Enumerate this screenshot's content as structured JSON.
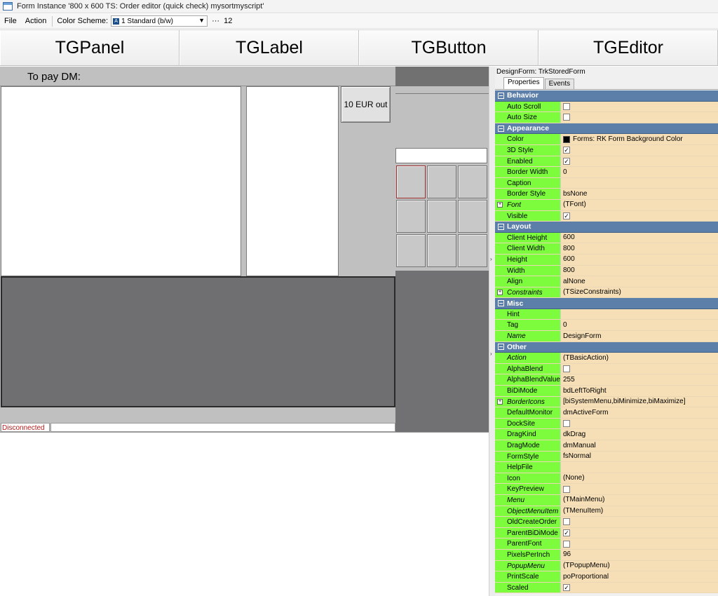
{
  "window": {
    "title": "Form Instance '800 x 600 TS: Order editor (quick check) mysortmyscript'"
  },
  "menu": {
    "file": "File",
    "action": "Action",
    "color_scheme_label": "Color Scheme:",
    "color_scheme_value": "1 Standard (b/w)",
    "more": "···",
    "count": "12"
  },
  "palette": [
    "TGPanel",
    "TGLabel",
    "TGButton",
    "TGEditor"
  ],
  "form": {
    "label": "To pay DM:",
    "eur_button": "10 EUR out",
    "status": "Disconnected"
  },
  "inspector": {
    "title": "DesignForm: TrkStoredForm",
    "tabs": [
      "Properties",
      "Events"
    ],
    "sections": [
      {
        "name": "Behavior",
        "rows": [
          {
            "name": "Auto Scroll",
            "type": "check",
            "checked": false
          },
          {
            "name": "Auto Size",
            "type": "check",
            "checked": false
          }
        ]
      },
      {
        "name": "Appearance",
        "rows": [
          {
            "name": "Color",
            "type": "color",
            "value": "Forms: RK Form Background Color",
            "color": "#000000"
          },
          {
            "name": "3D Style",
            "type": "check",
            "checked": true
          },
          {
            "name": "Enabled",
            "type": "check",
            "checked": true
          },
          {
            "name": "Border Width",
            "type": "text",
            "value": "0"
          },
          {
            "name": "Caption",
            "type": "text",
            "value": ""
          },
          {
            "name": "Border Style",
            "type": "text",
            "value": "bsNone"
          },
          {
            "name": "Font",
            "type": "text",
            "value": "(TFont)",
            "italic": true,
            "expand": true
          },
          {
            "name": "Visible",
            "type": "check",
            "checked": true
          }
        ]
      },
      {
        "name": "Layout",
        "rows": [
          {
            "name": "Client Height",
            "type": "text",
            "value": "600"
          },
          {
            "name": "Client Width",
            "type": "text",
            "value": "800"
          },
          {
            "name": "Height",
            "type": "text",
            "value": "600"
          },
          {
            "name": "Width",
            "type": "text",
            "value": "800"
          },
          {
            "name": "Align",
            "type": "text",
            "value": "alNone"
          },
          {
            "name": "Constraints",
            "type": "text",
            "value": "(TSizeConstraints)",
            "italic": true,
            "expand": true
          }
        ]
      },
      {
        "name": "Misc",
        "rows": [
          {
            "name": "Hint",
            "type": "text",
            "value": ""
          },
          {
            "name": "Tag",
            "type": "text",
            "value": "0"
          },
          {
            "name": "Name",
            "type": "text",
            "value": "DesignForm",
            "italic": true
          }
        ]
      },
      {
        "name": "Other",
        "rows": [
          {
            "name": "Action",
            "type": "text",
            "value": "(TBasicAction)",
            "italic": true
          },
          {
            "name": "AlphaBlend",
            "type": "check",
            "checked": false
          },
          {
            "name": "AlphaBlendValue",
            "type": "text",
            "value": "255"
          },
          {
            "name": "BiDiMode",
            "type": "text",
            "value": "bdLeftToRight"
          },
          {
            "name": "BorderIcons",
            "type": "text",
            "value": "[biSystemMenu,biMinimize,biMaximize]",
            "italic": true,
            "expand": true
          },
          {
            "name": "DefaultMonitor",
            "type": "text",
            "value": "dmActiveForm"
          },
          {
            "name": "DockSite",
            "type": "check",
            "checked": false
          },
          {
            "name": "DragKind",
            "type": "text",
            "value": "dkDrag"
          },
          {
            "name": "DragMode",
            "type": "text",
            "value": "dmManual"
          },
          {
            "name": "FormStyle",
            "type": "text",
            "value": "fsNormal"
          },
          {
            "name": "HelpFile",
            "type": "text",
            "value": ""
          },
          {
            "name": "Icon",
            "type": "text",
            "value": "(None)"
          },
          {
            "name": "KeyPreview",
            "type": "check",
            "checked": false
          },
          {
            "name": "Menu",
            "type": "text",
            "value": "(TMainMenu)",
            "italic": true
          },
          {
            "name": "ObjectMenuItem",
            "type": "text",
            "value": "(TMenuItem)",
            "italic": true
          },
          {
            "name": "OldCreateOrder",
            "type": "check",
            "checked": false
          },
          {
            "name": "ParentBiDiMode",
            "type": "check",
            "checked": true
          },
          {
            "name": "ParentFont",
            "type": "check",
            "checked": false
          },
          {
            "name": "PixelsPerInch",
            "type": "text",
            "value": "96"
          },
          {
            "name": "PopupMenu",
            "type": "text",
            "value": "(TPopupMenu)",
            "italic": true
          },
          {
            "name": "PrintScale",
            "type": "text",
            "value": "poProportional"
          },
          {
            "name": "Scaled",
            "type": "check",
            "checked": true
          }
        ]
      }
    ]
  }
}
